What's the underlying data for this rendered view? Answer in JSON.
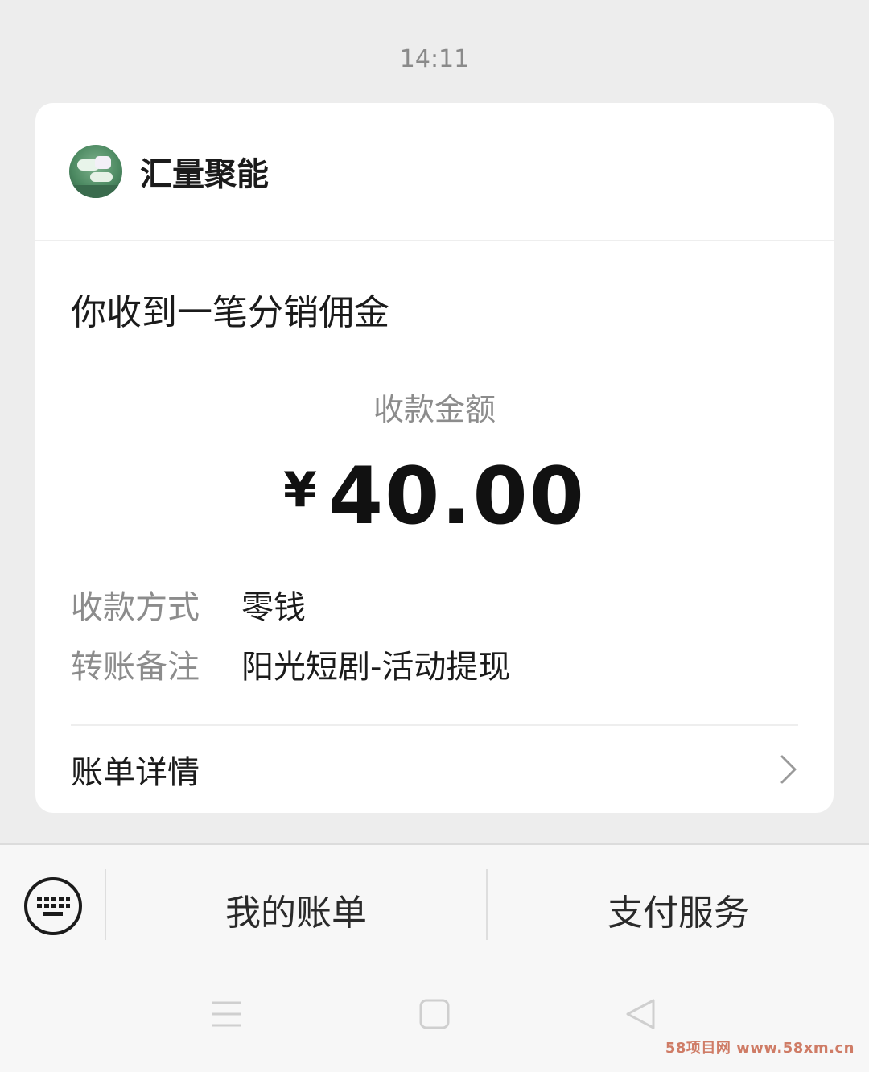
{
  "status": {
    "time": "14:11"
  },
  "card": {
    "merchant_name": "汇量聚能",
    "title": "你收到一笔分销佣金",
    "amount_label": "收款金额",
    "currency_symbol": "¥",
    "amount": "40.00",
    "rows": [
      {
        "label": "收款方式",
        "value": "零钱"
      },
      {
        "label": "转账备注",
        "value": "阳光短剧-活动提现"
      }
    ],
    "detail_label": "账单详情"
  },
  "bottom_menu": {
    "items": [
      {
        "label": "我的账单"
      },
      {
        "label": "支付服务"
      }
    ]
  },
  "watermark": "58项目网 www.58xm.cn",
  "colors": {
    "background": "#ededed",
    "card": "#ffffff",
    "secondary_text": "#8c8c8c",
    "primary_text": "#1b1b1b",
    "watermark": "#cf7c66"
  },
  "icons": [
    "avatar",
    "chevron-right-icon",
    "keyboard-icon",
    "menu-icon",
    "home-square-icon",
    "back-triangle-icon"
  ]
}
